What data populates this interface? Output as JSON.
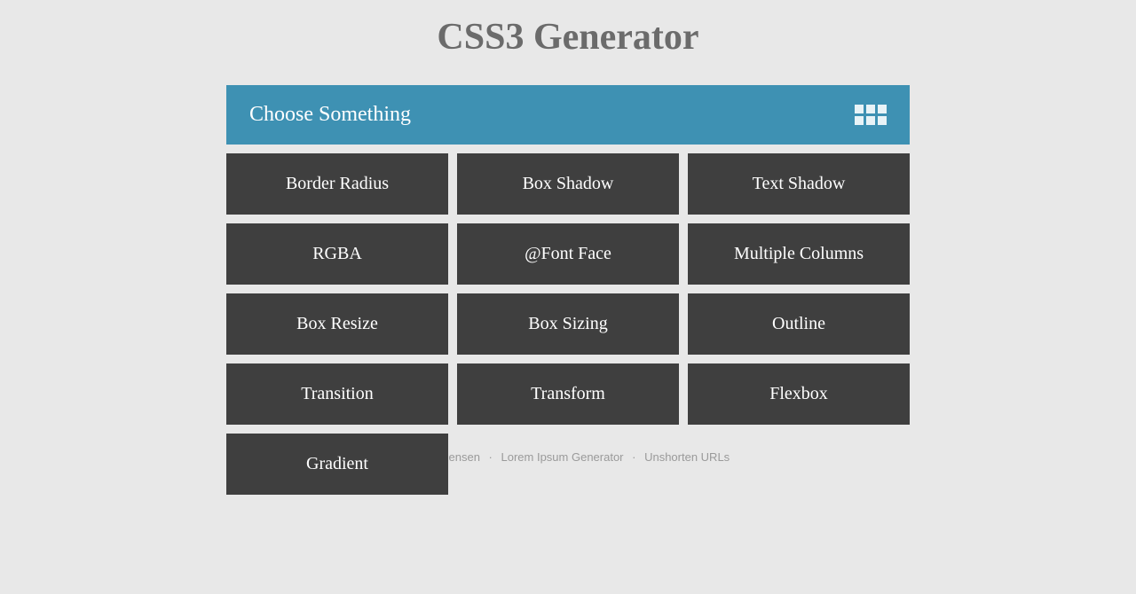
{
  "title": "CSS3 Generator",
  "header": {
    "label": "Choose Something"
  },
  "options": [
    "Border Radius",
    "Box Shadow",
    "Text Shadow",
    "RGBA",
    "@Font Face",
    "Multiple Columns",
    "Box Resize",
    "Box Sizing",
    "Outline",
    "Transition",
    "Transform",
    "Flexbox",
    "Gradient"
  ],
  "footer": {
    "author": "Randy Jensen",
    "link1": "Lorem Ipsum Generator",
    "link2": "Unshorten URLs"
  }
}
